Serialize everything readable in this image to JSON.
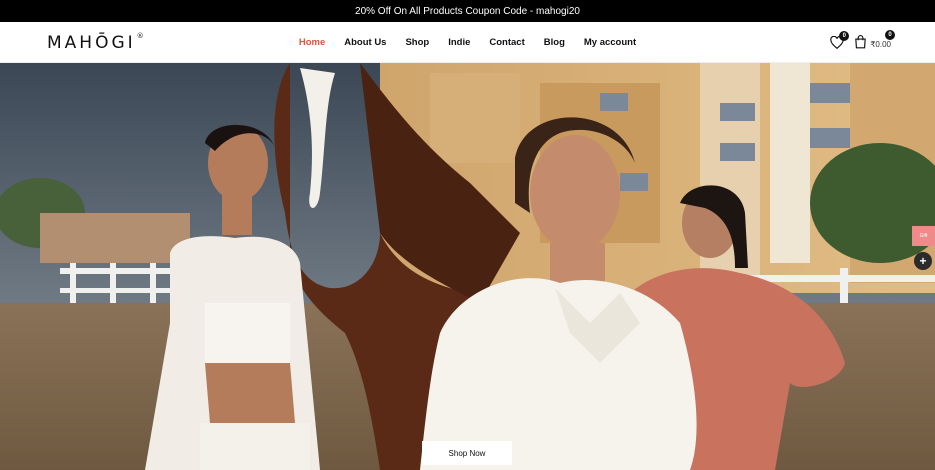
{
  "announcement": "20% Off On All Products Coupon Code  - mahogi20",
  "brand": {
    "name": "MAHŌGI",
    "mark": "®"
  },
  "nav": [
    {
      "label": "Home",
      "active": true
    },
    {
      "label": "About Us",
      "active": false
    },
    {
      "label": "Shop",
      "active": false
    },
    {
      "label": "Indie",
      "active": false
    },
    {
      "label": "Contact",
      "active": false
    },
    {
      "label": "Blog",
      "active": false
    },
    {
      "label": "My account",
      "active": false
    }
  ],
  "wishlist": {
    "count": "0"
  },
  "cart": {
    "count": "0",
    "total": "₹0.00"
  },
  "hero": {
    "cta": "Shop Now"
  },
  "side": {
    "tab_label": "Gift",
    "plus": "+"
  },
  "colors": {
    "accent": "#d9573c",
    "topbar": "#000000",
    "tab": "#f08a8a"
  }
}
